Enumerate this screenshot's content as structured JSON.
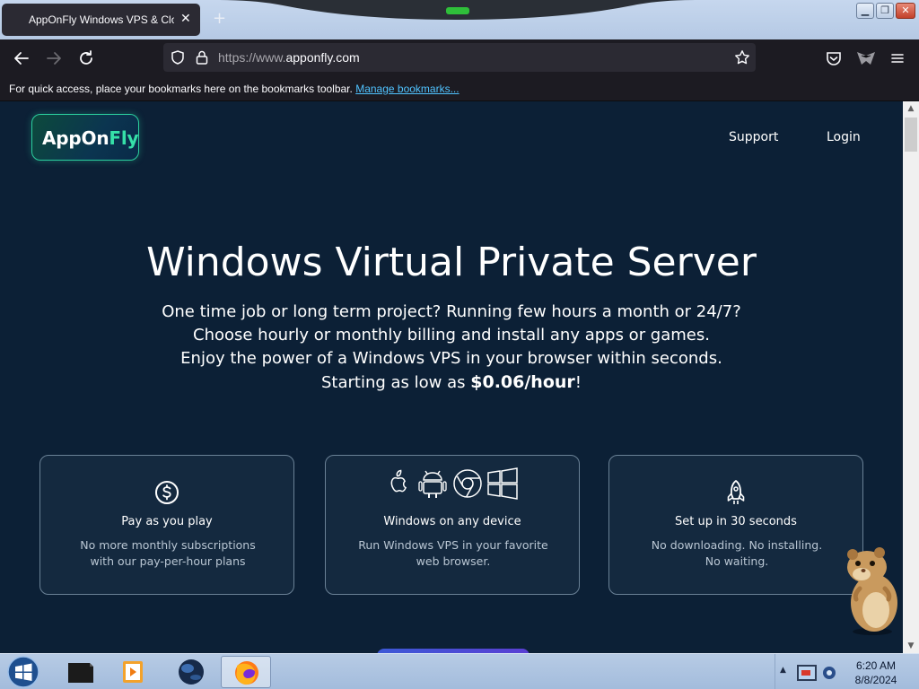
{
  "browser": {
    "tab_title": "AppOnFly Windows VPS & Clou",
    "tab_close": "✕",
    "new_tab": "+",
    "window_controls": {
      "minimize": "▁",
      "restore": "❐",
      "close": "✕"
    },
    "url": {
      "protocol": "https://www.",
      "domain": "apponfly.com"
    },
    "bookmarks_message": "For quick access, place your bookmarks here on the bookmarks toolbar.",
    "manage_bookmarks_link": "Manage bookmarks...",
    "icons": [
      "back-arrow-icon",
      "forward-arrow-icon",
      "reload-icon",
      "shield-icon",
      "lock-icon",
      "star-icon",
      "pocket-icon",
      "extension-icon",
      "menu-icon"
    ]
  },
  "site": {
    "logo_main": "AppOn",
    "logo_accent": "Fly",
    "nav": {
      "support": "Support",
      "login": "Login"
    },
    "hero": {
      "title": "Windows Virtual Private Server",
      "line1": "One time job or long term project? Running few hours a month or 24/7?",
      "line2": "Choose hourly or monthly billing and install any apps or games.",
      "line3": "Enjoy the power of a Windows VPS in your browser within seconds.",
      "line4_prefix": "Starting as low as ",
      "price": "$0.06/hour",
      "line4_suffix": "!"
    },
    "cards": [
      {
        "title": "Pay as you play",
        "desc1": "No more monthly subscriptions",
        "desc2": "with our pay-per-hour plans",
        "icon": "dollar-coin-icon"
      },
      {
        "title": "Windows on any device",
        "desc1": "Run Windows VPS in your favorite",
        "desc2": "web browser.",
        "icons": [
          "apple-icon",
          "android-icon",
          "chrome-icon",
          "windows-icon"
        ]
      },
      {
        "title": "Set up in 30 seconds",
        "desc1": "No downloading. No installing.",
        "desc2": "No waiting.",
        "icon": "rocket-icon"
      }
    ]
  },
  "taskbar": {
    "items": [
      "start-orb",
      "terminal-app",
      "media-player-app",
      "globe-app",
      "firefox-app"
    ],
    "clock_time": "6:20 AM",
    "clock_date": "8/8/2024",
    "tray_arrow": "▲"
  },
  "colors": {
    "page_bg": "#0c2036",
    "accent_green": "#36e0a8",
    "link_blue": "#50c3ff",
    "toolbar": "#1c1b22"
  }
}
